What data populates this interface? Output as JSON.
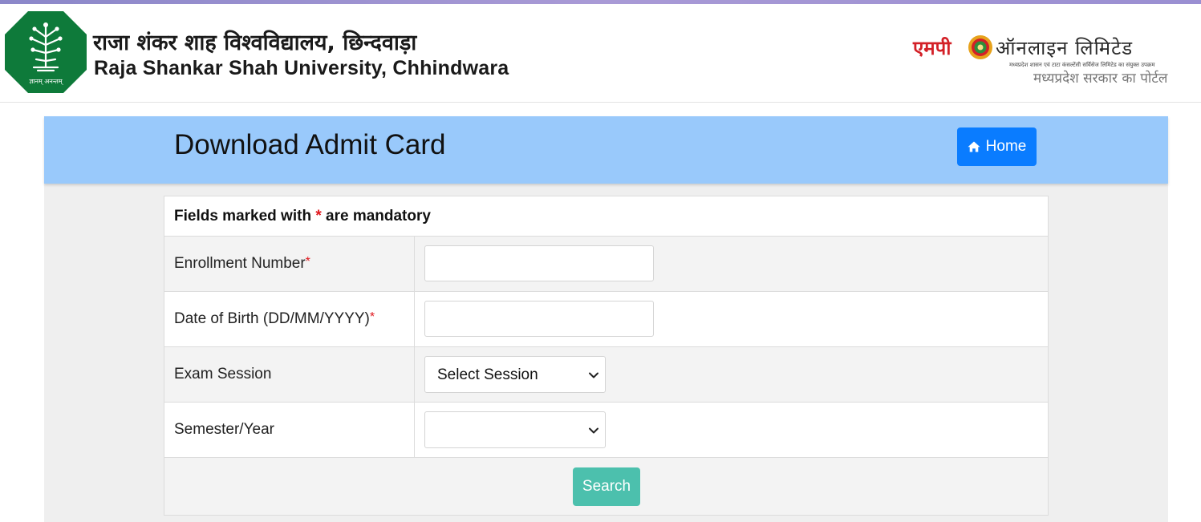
{
  "header": {
    "university_hindi": "राजा शंकर शाह विश्वविद्यालय, छिन्दवाड़ा",
    "university_english": "Raja Shankar Shah University, Chhindwara",
    "logo_motto": "ज्ञानम् अनन्तम्",
    "mponline": {
      "red_text": "एमपी",
      "rest_text": "ऑनलाइन लिमिटेड",
      "small_text": "मध्यप्रदेश शासन एवं टाटा कंसल्टेंसी सर्विसेज लिमिटेड का संयुक्त उपक्रम",
      "sub_text": "मध्यप्रदेश सरकार का पोर्टल"
    }
  },
  "banner": {
    "title": "Download Admit Card",
    "home_label": "Home",
    "home_icon": "home-icon"
  },
  "form": {
    "mandatory_prefix": "Fields marked with ",
    "mandatory_star": "*",
    "mandatory_suffix": " are mandatory",
    "fields": [
      {
        "label": "Enrollment Number",
        "required": "*",
        "value": ""
      },
      {
        "label": "Date of Birth (DD/MM/YYYY)",
        "required": "*",
        "value": ""
      },
      {
        "label": "Exam Session",
        "selected": "Select Session"
      },
      {
        "label": "Semester/Year",
        "selected": ""
      }
    ],
    "search_label": "Search"
  },
  "colors": {
    "banner_bg": "#99c9fb",
    "home_button": "#0a7cff",
    "search_button": "#4cc0ad",
    "required_star": "#e0181e",
    "brand_red": "#d32027",
    "logo_green": "#0e7a3a"
  }
}
